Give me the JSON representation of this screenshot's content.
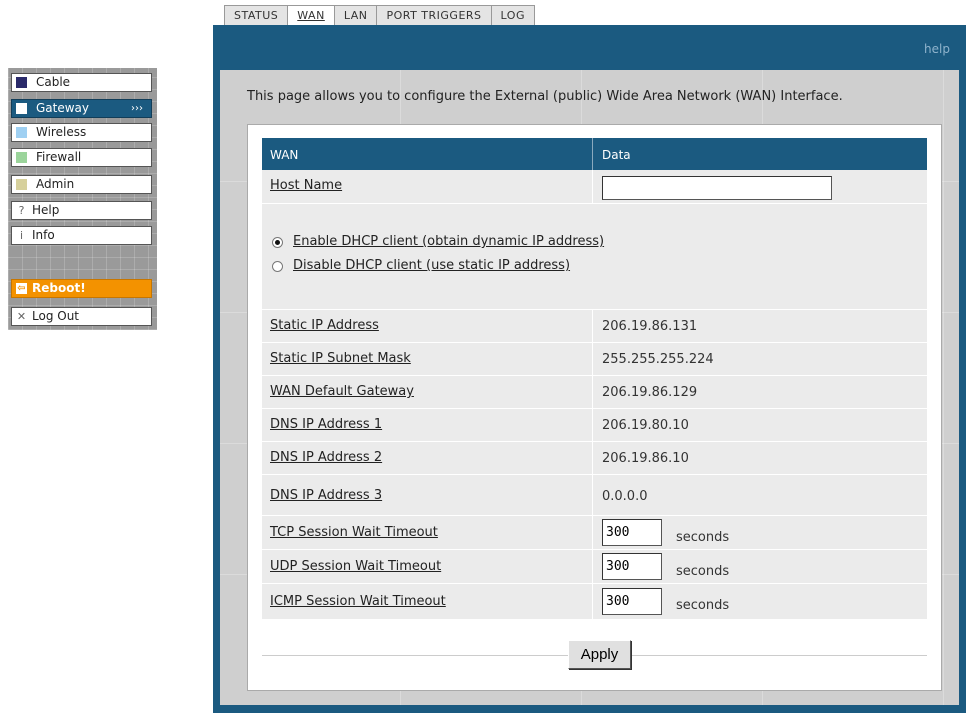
{
  "colors": {
    "brand_blue": "#1b5a80",
    "reboot_orange": "#f39200",
    "panel_gray": "#cfcfcf",
    "row_gray": "#ebebeb"
  },
  "tabs": [
    {
      "label": "STATUS",
      "active": false
    },
    {
      "label": "WAN",
      "active": true
    },
    {
      "label": "LAN",
      "active": false
    },
    {
      "label": "PORT TRIGGERS",
      "active": false
    },
    {
      "label": "LOG",
      "active": false
    }
  ],
  "header": {
    "help_label": "help"
  },
  "menu": {
    "items": [
      {
        "label": "Cable",
        "icon": "square-navy",
        "color": "#2a2a6a"
      },
      {
        "label": "Gateway",
        "icon": "square-white",
        "color": "#ffffff",
        "arrow": "›››"
      },
      {
        "label": "Wireless",
        "icon": "square-lightblue",
        "color": "#9fd0f2"
      },
      {
        "label": "Firewall",
        "icon": "square-green",
        "color": "#9bd49b"
      },
      {
        "label": "Admin",
        "icon": "square-tan",
        "color": "#d6d09c"
      },
      {
        "label": "Help",
        "icon": "question-icon",
        "glyph": "?"
      },
      {
        "label": "Info",
        "icon": "info-icon",
        "glyph": "i"
      }
    ],
    "reboot_label": "Reboot!",
    "logout_label": "Log Out"
  },
  "intro": "This page allows you to configure the External (public) Wide Area Network (WAN) Interface.",
  "table": {
    "col1": "WAN",
    "col2": "Data",
    "host_name_label": "Host Name",
    "host_name_value": "",
    "dhcp_enable_label": "Enable DHCP client (obtain dynamic IP address)",
    "dhcp_disable_label": "Disable DHCP client (use static IP address)",
    "dhcp_enabled": true,
    "static_ip_label": "Static IP Address",
    "static_ip": "206.19.86.131",
    "subnet_label": "Static IP Subnet Mask",
    "subnet": "255.255.255.224",
    "gateway_label": "WAN Default Gateway",
    "gateway": "206.19.86.129",
    "dns1_label": "DNS IP Address 1",
    "dns1": "206.19.80.10",
    "dns2_label": "DNS IP Address 2",
    "dns2": "206.19.86.10",
    "dns3_label": "DNS IP Address 3",
    "dns3": "0.0.0.0",
    "tcp_label": "TCP Session Wait Timeout",
    "tcp_value": "300",
    "udp_label": "UDP Session Wait Timeout",
    "udp_value": "300",
    "icmp_label": "ICMP Session Wait Timeout",
    "icmp_value": "300",
    "seconds_unit": "seconds"
  },
  "apply_label": "Apply"
}
